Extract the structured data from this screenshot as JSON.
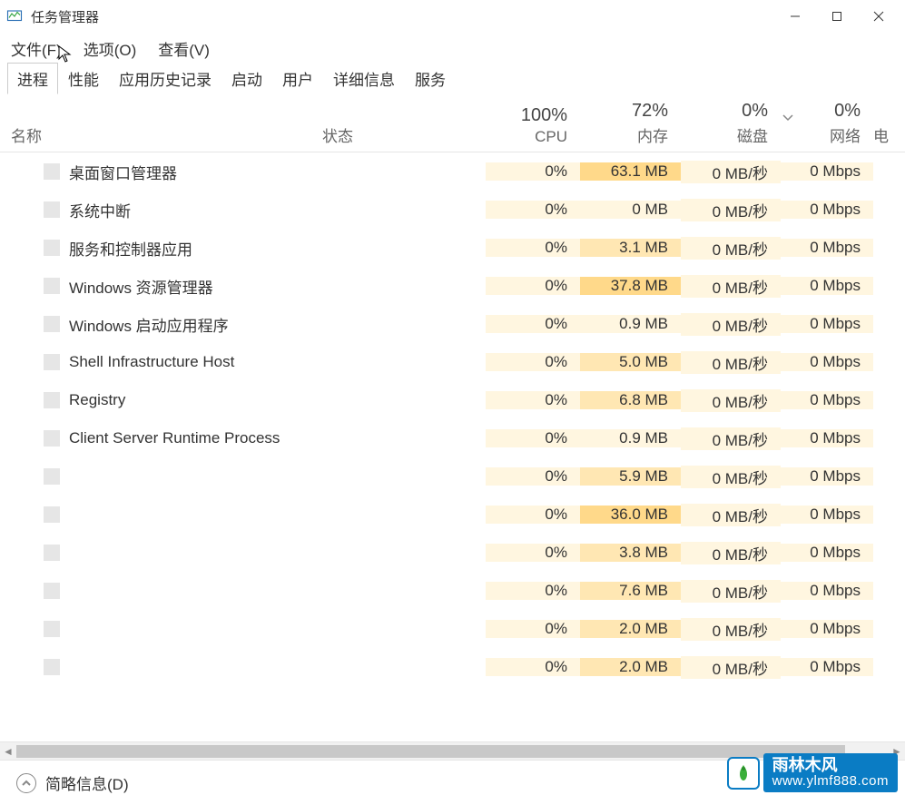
{
  "window": {
    "title": "任务管理器"
  },
  "menu": {
    "file": "文件(F)",
    "options": "选项(O)",
    "view": "查看(V)"
  },
  "tabs": {
    "processes": "进程",
    "performance": "性能",
    "app_history": "应用历史记录",
    "startup": "启动",
    "users": "用户",
    "details": "详细信息",
    "services": "服务"
  },
  "columns": {
    "name": "名称",
    "status": "状态",
    "cpu_pct": "100%",
    "cpu_label": "CPU",
    "mem_pct": "72%",
    "mem_label": "内存",
    "disk_pct": "0%",
    "disk_label": "磁盘",
    "net_pct": "0%",
    "net_label": "网络",
    "extra": "电"
  },
  "processes": [
    {
      "name": "桌面窗口管理器",
      "cpu": "0%",
      "mem": "63.1 MB",
      "mem_heat": "high",
      "disk": "0 MB/秒",
      "net": "0 Mbps"
    },
    {
      "name": "系统中断",
      "cpu": "0%",
      "mem": "0 MB",
      "mem_heat": "low",
      "disk": "0 MB/秒",
      "net": "0 Mbps"
    },
    {
      "name": "服务和控制器应用",
      "cpu": "0%",
      "mem": "3.1 MB",
      "mem_heat": "med",
      "disk": "0 MB/秒",
      "net": "0 Mbps"
    },
    {
      "name": "Windows 资源管理器",
      "cpu": "0%",
      "mem": "37.8 MB",
      "mem_heat": "high",
      "disk": "0 MB/秒",
      "net": "0 Mbps"
    },
    {
      "name": "Windows 启动应用程序",
      "cpu": "0%",
      "mem": "0.9 MB",
      "mem_heat": "low",
      "disk": "0 MB/秒",
      "net": "0 Mbps"
    },
    {
      "name": "Shell Infrastructure Host",
      "cpu": "0%",
      "mem": "5.0 MB",
      "mem_heat": "med",
      "disk": "0 MB/秒",
      "net": "0 Mbps"
    },
    {
      "name": "Registry",
      "cpu": "0%",
      "mem": "6.8 MB",
      "mem_heat": "med",
      "disk": "0 MB/秒",
      "net": "0 Mbps"
    },
    {
      "name": "Client Server Runtime Process",
      "cpu": "0%",
      "mem": "0.9 MB",
      "mem_heat": "low",
      "disk": "0 MB/秒",
      "net": "0 Mbps"
    },
    {
      "name": "",
      "cpu": "0%",
      "mem": "5.9 MB",
      "mem_heat": "med",
      "disk": "0 MB/秒",
      "net": "0 Mbps"
    },
    {
      "name": "",
      "cpu": "0%",
      "mem": "36.0 MB",
      "mem_heat": "high",
      "disk": "0 MB/秒",
      "net": "0 Mbps"
    },
    {
      "name": "",
      "cpu": "0%",
      "mem": "3.8 MB",
      "mem_heat": "med",
      "disk": "0 MB/秒",
      "net": "0 Mbps"
    },
    {
      "name": "",
      "cpu": "0%",
      "mem": "7.6 MB",
      "mem_heat": "med",
      "disk": "0 MB/秒",
      "net": "0 Mbps"
    },
    {
      "name": "",
      "cpu": "0%",
      "mem": "2.0 MB",
      "mem_heat": "med",
      "disk": "0 MB/秒",
      "net": "0 Mbps"
    },
    {
      "name": "",
      "cpu": "0%",
      "mem": "2.0 MB",
      "mem_heat": "med",
      "disk": "0 MB/秒",
      "net": "0 Mbps"
    }
  ],
  "footer": {
    "less_details": "简略信息(D)"
  },
  "watermark": {
    "brand": "雨林木风",
    "url": "www.ylmf888.com"
  }
}
